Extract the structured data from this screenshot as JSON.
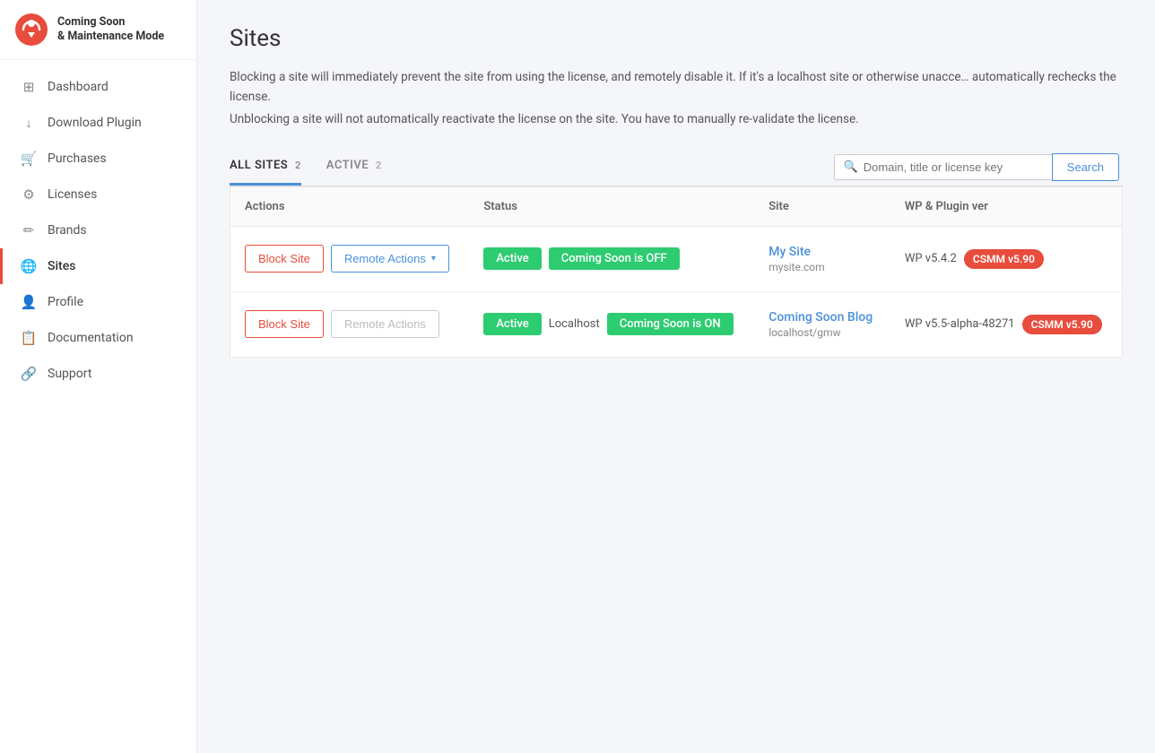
{
  "app": {
    "logo_line1": "Coming Soon",
    "logo_line2": "& Maintenance Mode"
  },
  "sidebar": {
    "items": [
      {
        "id": "dashboard",
        "label": "Dashboard",
        "icon": "dashboard"
      },
      {
        "id": "download-plugin",
        "label": "Download Plugin",
        "icon": "download"
      },
      {
        "id": "purchases",
        "label": "Purchases",
        "icon": "purchases"
      },
      {
        "id": "licenses",
        "label": "Licenses",
        "icon": "licenses"
      },
      {
        "id": "brands",
        "label": "Brands",
        "icon": "brands"
      },
      {
        "id": "sites",
        "label": "Sites",
        "icon": "sites",
        "active": true
      },
      {
        "id": "profile",
        "label": "Profile",
        "icon": "profile"
      },
      {
        "id": "documentation",
        "label": "Documentation",
        "icon": "documentation"
      },
      {
        "id": "support",
        "label": "Support",
        "icon": "support"
      }
    ]
  },
  "page": {
    "title": "Sites",
    "desc1": "Blocking a site will immediately prevent the site from using the license, and remotely disable it. If it's a localhost site or otherwise unacce… automatically rechecks the license.",
    "desc2": "Unblocking a site will not automatically reactivate the license on the site. You have to manually re-validate the license."
  },
  "tabs": [
    {
      "id": "all-sites",
      "label": "ALL SITES",
      "count": "2",
      "active": true
    },
    {
      "id": "active",
      "label": "ACTIVE",
      "count": "2",
      "active": false
    }
  ],
  "search": {
    "placeholder": "Domain, title or license key",
    "button_label": "Search"
  },
  "table": {
    "headers": [
      "Actions",
      "Status",
      "Site",
      "WP & Plugin ver"
    ],
    "rows": [
      {
        "block_label": "Block Site",
        "remote_label": "Remote Actions",
        "remote_chevron": "▾",
        "status_label": "Active",
        "coming_soon_label": "Coming Soon is OFF",
        "site_name": "My Site",
        "site_url": "mysite.com",
        "wp_ver": "WP v5.4.2",
        "plugin_ver": "CSMM v5.90",
        "remote_disabled": false
      },
      {
        "block_label": "Block Site",
        "remote_label": "Remote Actions",
        "remote_chevron": "",
        "status_label": "Active",
        "localhost_label": "Localhost",
        "coming_soon_label": "Coming Soon is ON",
        "site_name": "Coming Soon Blog",
        "site_url": "localhost/gmw",
        "wp_ver": "WP v5.5-alpha-48271",
        "plugin_ver": "CSMM v5.90",
        "remote_disabled": true
      }
    ]
  }
}
